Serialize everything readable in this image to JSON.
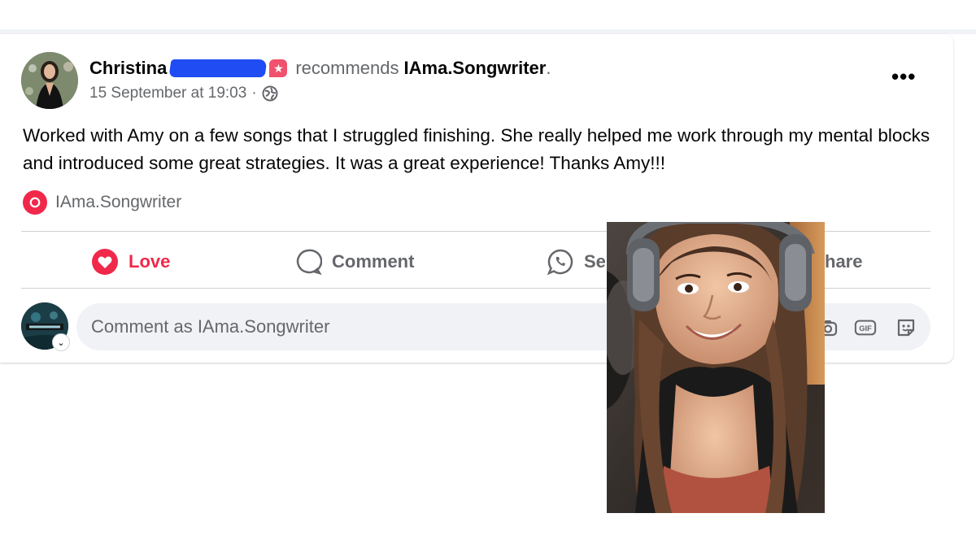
{
  "post": {
    "author": "Christina",
    "recommends_text": "recommends",
    "page_name": "IAma.Songwriter",
    "trailing_dot": ".",
    "timestamp": "15 September at 19:03",
    "separator": "·",
    "body": "Worked with Amy on a few songs that I struggled finishing. She really helped me work through my mental blocks and introduced some great strategies. It was a great experience! Thanks Amy!!!",
    "page_tag": "IAma.Songwriter",
    "more_label": "•••"
  },
  "actions": {
    "love": "Love",
    "comment": "Comment",
    "send_partial": "Se",
    "share_partial": "hare"
  },
  "composer": {
    "placeholder": "Comment as IAma.Songwriter",
    "gif_label": "GIF"
  },
  "colors": {
    "love_red": "#f0284a",
    "redaction_blue": "#1f4cf3",
    "secondary_text": "#65676b"
  },
  "icons": [
    "globe-icon",
    "heart-icon",
    "comment-icon",
    "whatsapp-icon",
    "camera-icon",
    "gif-icon",
    "sticker-icon",
    "more-icon",
    "recommend-icon"
  ]
}
